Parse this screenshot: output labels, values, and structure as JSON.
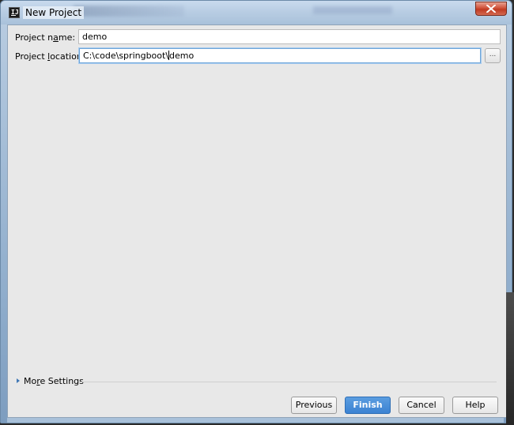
{
  "window": {
    "title": "New Project",
    "icon": "intellij-idea-icon",
    "close_icon": "close-icon"
  },
  "form": {
    "project_name": {
      "label_prefix": "Project n",
      "label_mnemonic": "a",
      "label_suffix": "me:",
      "value": "demo"
    },
    "project_location": {
      "label_prefix": "Project ",
      "label_mnemonic": "l",
      "label_suffix": "ocation:",
      "value_before_caret": "C:\\code\\springboot\\",
      "value_after_caret": "demo",
      "browse_label": "..."
    }
  },
  "more_settings": {
    "label_prefix": "Mo",
    "label_mnemonic": "r",
    "label_suffix": "e Settings",
    "icon": "expand-triangle-icon"
  },
  "buttons": {
    "previous": "Previous",
    "finish": "Finish",
    "cancel": "Cancel",
    "help": "Help"
  },
  "colors": {
    "primary_button": "#3b82d2",
    "focus_border": "#6ea5d8",
    "close_button": "#c03a22",
    "dialog_background": "#e8e8e8"
  }
}
